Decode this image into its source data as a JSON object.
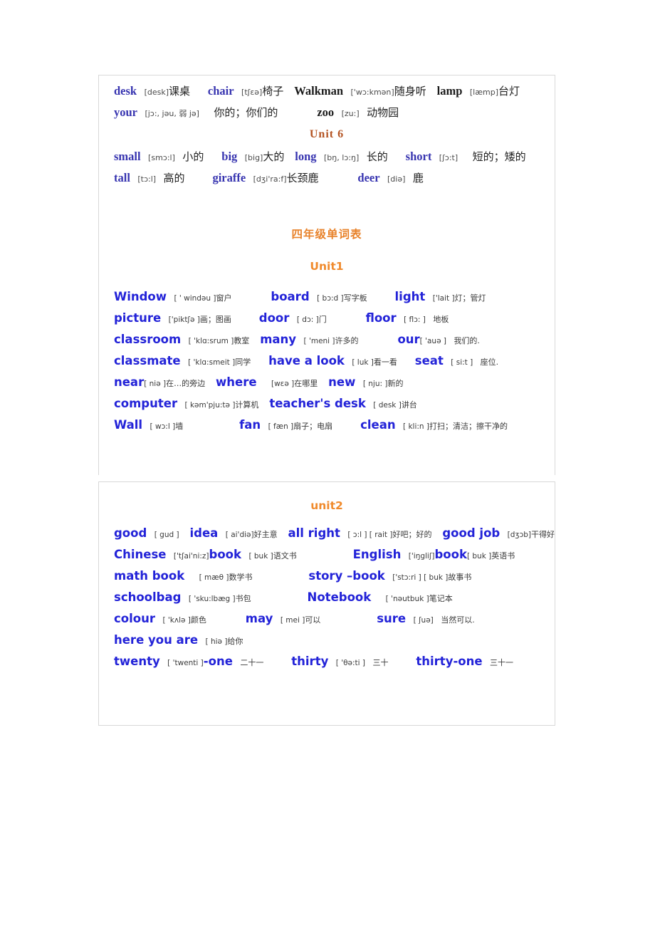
{
  "document": {
    "kind": "vocabulary-word-list",
    "colors": {
      "word_blue_serif": "#3734b0",
      "word_blue_sans": "#2323d8",
      "heading_orange": "#f08a2c",
      "heading_brown": "#b45423",
      "panel_border": "#d8d8d8",
      "page_background": "#ffffff"
    }
  },
  "panel_one": {
    "grade3_tail": {
      "rows": [
        {
          "entries": [
            {
              "word": "desk",
              "phonetic": "[desk]",
              "meaning": "课桌"
            },
            {
              "word": "chair",
              "phonetic": "[tʃɛə]",
              "meaning": "椅子"
            },
            {
              "word": "Walkman",
              "phonetic": "['wɔ:kmən]",
              "meaning": "随身听",
              "dark": true
            },
            {
              "word": "lamp",
              "phonetic": "[læmp]",
              "meaning": "台灯",
              "dark": true
            }
          ]
        },
        {
          "entries": [
            {
              "word": "your",
              "phonetic": "[jɔ:, jəu, 弱 jə]",
              "meaning": "你的；你们的"
            },
            {
              "word": "zoo",
              "phonetic": "[zu:]",
              "meaning": "动物园",
              "dark": true
            }
          ]
        }
      ]
    },
    "unit6_heading": "Unit  6",
    "unit6": {
      "rows": [
        {
          "entries": [
            {
              "word": "small",
              "phonetic": "[smɔ:l]",
              "meaning": "小的"
            },
            {
              "word": "big",
              "phonetic": "[big]",
              "meaning": "大的"
            },
            {
              "word": "long",
              "phonetic": "[bŋ, lɔ:ŋ]",
              "meaning": "长的"
            },
            {
              "word": "short",
              "phonetic": "[ʃɔ:t]",
              "meaning": "短的；矮的"
            }
          ]
        },
        {
          "entries": [
            {
              "word": "tall",
              "phonetic": "[tɔ:l]",
              "meaning": "高的"
            },
            {
              "word": "giraffe",
              "phonetic": "[dʒi'ra:f]",
              "meaning": "长颈鹿"
            },
            {
              "word": "deer",
              "phonetic": "[diə]",
              "meaning": "鹿"
            }
          ]
        }
      ]
    },
    "grade4_title": "四年级单词表",
    "unit1_heading": "Unit1",
    "unit1": {
      "rows": [
        {
          "entries": [
            {
              "word": "Window",
              "phonetic": "[ ' windəu ]",
              "meaning": "窗户"
            },
            {
              "word": "board",
              "phonetic": "[ bɔ:d ]",
              "meaning": "写字板"
            },
            {
              "word": "light",
              "phonetic": "['lait ]",
              "meaning": "灯；管灯"
            }
          ]
        },
        {
          "entries": [
            {
              "word": "picture",
              "phonetic": "['piktʃə ]",
              "meaning": "画；图画"
            },
            {
              "word": "door",
              "phonetic": "[ dɔ: ]",
              "meaning": "门"
            },
            {
              "word": "floor",
              "phonetic": "[ flɔ: ]",
              "meaning": "地板"
            }
          ]
        },
        {
          "entries": [
            {
              "word": "classroom",
              "phonetic": "[ 'klɑ:srum ]",
              "meaning": "教室"
            },
            {
              "word": "many",
              "phonetic": "[ 'meni ]",
              "meaning": "许多的"
            },
            {
              "word": "our",
              "phonetic": "[ 'auə ]",
              "meaning": "我们的."
            }
          ]
        },
        {
          "entries": [
            {
              "word": "classmate",
              "phonetic": "[ 'klɑ:smeit ]",
              "meaning": "同学"
            },
            {
              "word": "have a look",
              "phonetic": "[ luk ]",
              "meaning": "看一看"
            },
            {
              "word": "seat",
              "phonetic": "[ si:t ]",
              "meaning": "座位."
            }
          ]
        },
        {
          "entries": [
            {
              "word": "near",
              "phonetic": "[ niə ]",
              "meaning": "在…的旁边"
            },
            {
              "word": "where",
              "phonetic": "[wɛə ]",
              "meaning": "在哪里"
            },
            {
              "word": "new",
              "phonetic": "[ nju: ]",
              "meaning": "新的"
            }
          ]
        },
        {
          "entries": [
            {
              "word": "computer",
              "phonetic": "[ kəm'pju:tə ]",
              "meaning": "计算机"
            },
            {
              "word": "teacher's desk",
              "phonetic": "[ desk ]",
              "meaning": "讲台"
            }
          ]
        },
        {
          "entries": [
            {
              "word": "Wall",
              "phonetic": "[ wɔ:l ]",
              "meaning": "墙"
            },
            {
              "word": "fan",
              "phonetic": "[ fæn ]",
              "meaning": "扇子；电扇"
            },
            {
              "word": "clean",
              "phonetic": "[ kli:n ]",
              "meaning": "打扫；清洁；擦干净的"
            }
          ]
        }
      ]
    }
  },
  "panel_two": {
    "unit2_heading": "unit2",
    "unit2": {
      "rows": [
        {
          "entries": [
            {
              "word": "good",
              "phonetic": "[ gud ]",
              "meaning": ""
            },
            {
              "word": "idea",
              "phonetic": "[ ai'diə]",
              "meaning": "好主意"
            },
            {
              "word": "all right",
              "phonetic": "[ ɔ:l ] [ rait ]",
              "meaning": "好吧；好的"
            },
            {
              "word": "good job",
              "phonetic": "[dʒɔb]",
              "meaning": "干得好"
            }
          ]
        },
        {
          "entries": [
            {
              "word": "Chinese",
              "phonetic": "['tʃai'ni:z]",
              "meaning": ""
            },
            {
              "word": "book",
              "phonetic": "[ buk ]",
              "meaning": "语文书"
            },
            {
              "word": "English",
              "phonetic": "['iŋgliʃ]",
              "meaning": ""
            },
            {
              "word": "book",
              "phonetic": "[ buk ]",
              "meaning": "英语书"
            }
          ]
        },
        {
          "entries": [
            {
              "word": "math book",
              "phonetic": "[ mæθ ]",
              "meaning": "数学书"
            },
            {
              "word": "story –book",
              "phonetic": "['stɔ:ri ] [ buk ]",
              "meaning": "故事书"
            }
          ]
        },
        {
          "entries": [
            {
              "word": "schoolbag",
              "phonetic": "[ 'sku:lbæg ]",
              "meaning": "书包"
            },
            {
              "word": "Notebook",
              "phonetic": "[ 'nəutbuk ]",
              "meaning": "笔记本"
            }
          ]
        },
        {
          "entries": [
            {
              "word": "colour",
              "phonetic": "[ 'kʌlə ]",
              "meaning": "颜色"
            },
            {
              "word": "may",
              "phonetic": "[ mei ]",
              "meaning": "可以"
            },
            {
              "word": "sure",
              "phonetic": "[ ʃuə]",
              "meaning": "当然可以."
            }
          ]
        },
        {
          "entries": [
            {
              "word": "here you are",
              "phonetic": "[ hiə ]",
              "meaning": "给你"
            }
          ]
        },
        {
          "entries": [
            {
              "word": "twenty",
              "phonetic": "[ 'twenti ]",
              "meaning": ""
            },
            {
              "word": "-one",
              "phonetic": "",
              "meaning": "二十一"
            },
            {
              "word": "thirty",
              "phonetic": "[ 'θə:ti ]",
              "meaning": "三十"
            },
            {
              "word": "thirty-one",
              "phonetic": "",
              "meaning": "三十一"
            }
          ]
        }
      ]
    }
  }
}
